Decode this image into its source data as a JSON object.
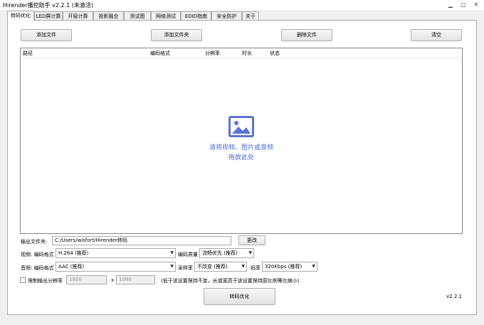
{
  "window": {
    "title": "Hirender播控助手 v2.2.1 (未激活)"
  },
  "tabs": [
    {
      "label": "转码优化"
    },
    {
      "label": "LED屏计算"
    },
    {
      "label": "开窗计算"
    },
    {
      "label": "投影融合"
    },
    {
      "label": "测试图"
    },
    {
      "label": "网络测试"
    },
    {
      "label": "EDID指南"
    },
    {
      "label": "安全防护"
    },
    {
      "label": "关于"
    }
  ],
  "toolbar": {
    "add_file": "添加文件",
    "add_folder": "添加文件夹",
    "delete_file": "删除文件",
    "clear": "清空"
  },
  "list": {
    "columns": [
      "路径",
      "编码格式",
      "分辨率",
      "时长",
      "状态"
    ],
    "drop_line1": "请将视频、图片或音频",
    "drop_line2": "拖放此处"
  },
  "output": {
    "folder_label": "输出文件夹:",
    "folder_value": "C:/Users/wisfort/Hirender转码",
    "change_button": "更改"
  },
  "video": {
    "codec_label": "视频: 编码格式",
    "codec_value": "H.264 (推荐)",
    "quality_label": "编码质量",
    "quality_value": "流畅优先 (推荐)"
  },
  "audio": {
    "codec_label": "音频: 编码格式",
    "codec_value": "AAC (推荐)",
    "samplerate_label": "采样率",
    "samplerate_value": "不改变 (推荐)",
    "bitrate_label": "码率",
    "bitrate_value": "320Kbps (推荐)"
  },
  "limit": {
    "label": "限制输出分辨率",
    "width": "1920",
    "x": "x",
    "height": "1080",
    "hint": "(低于该设置保持不变，长或宽高于该设置保持原比例等比缩小)"
  },
  "start_button": "转码优化",
  "version": "v2.2.1"
}
